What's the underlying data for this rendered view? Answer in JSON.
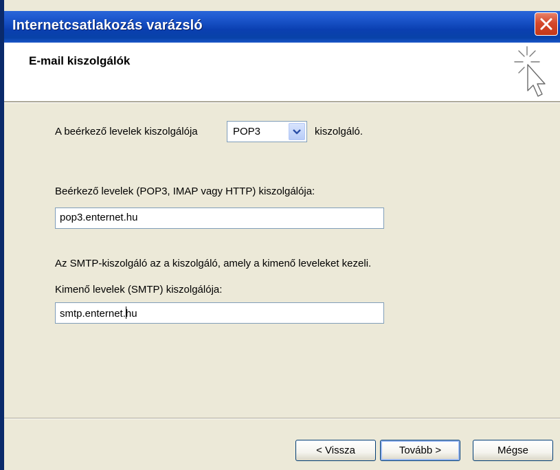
{
  "window": {
    "title": "Internetcsatlakozás varázsló"
  },
  "header": {
    "title": "E-mail kiszolgálók"
  },
  "icons": {
    "close": "close-icon",
    "wizard": "wizard-cursor-icon",
    "dropdown": "chevron-down-icon"
  },
  "colors": {
    "titlebar": "#0a3fb0",
    "close_button": "#d5482c",
    "dialog_background": "#ece9d8"
  },
  "incoming_type": {
    "prefix_label": "A beérkező levelek kiszolgálója",
    "value": "POP3",
    "suffix_label": "kiszolgáló."
  },
  "incoming_server": {
    "label": "Beérkező levelek (POP3, IMAP vagy HTTP) kiszolgálója:",
    "value": "pop3.enternet.hu"
  },
  "smtp_info": "Az SMTP-kiszolgáló az a kiszolgáló, amely a kimenő leveleket kezeli.",
  "outgoing_server": {
    "label": "Kimenő levelek (SMTP) kiszolgálója:",
    "value_before_caret": "smtp.enternet.",
    "value_after_caret": "hu"
  },
  "buttons": {
    "back": "< Vissza",
    "next": "Tovább >",
    "cancel": "Mégse"
  }
}
